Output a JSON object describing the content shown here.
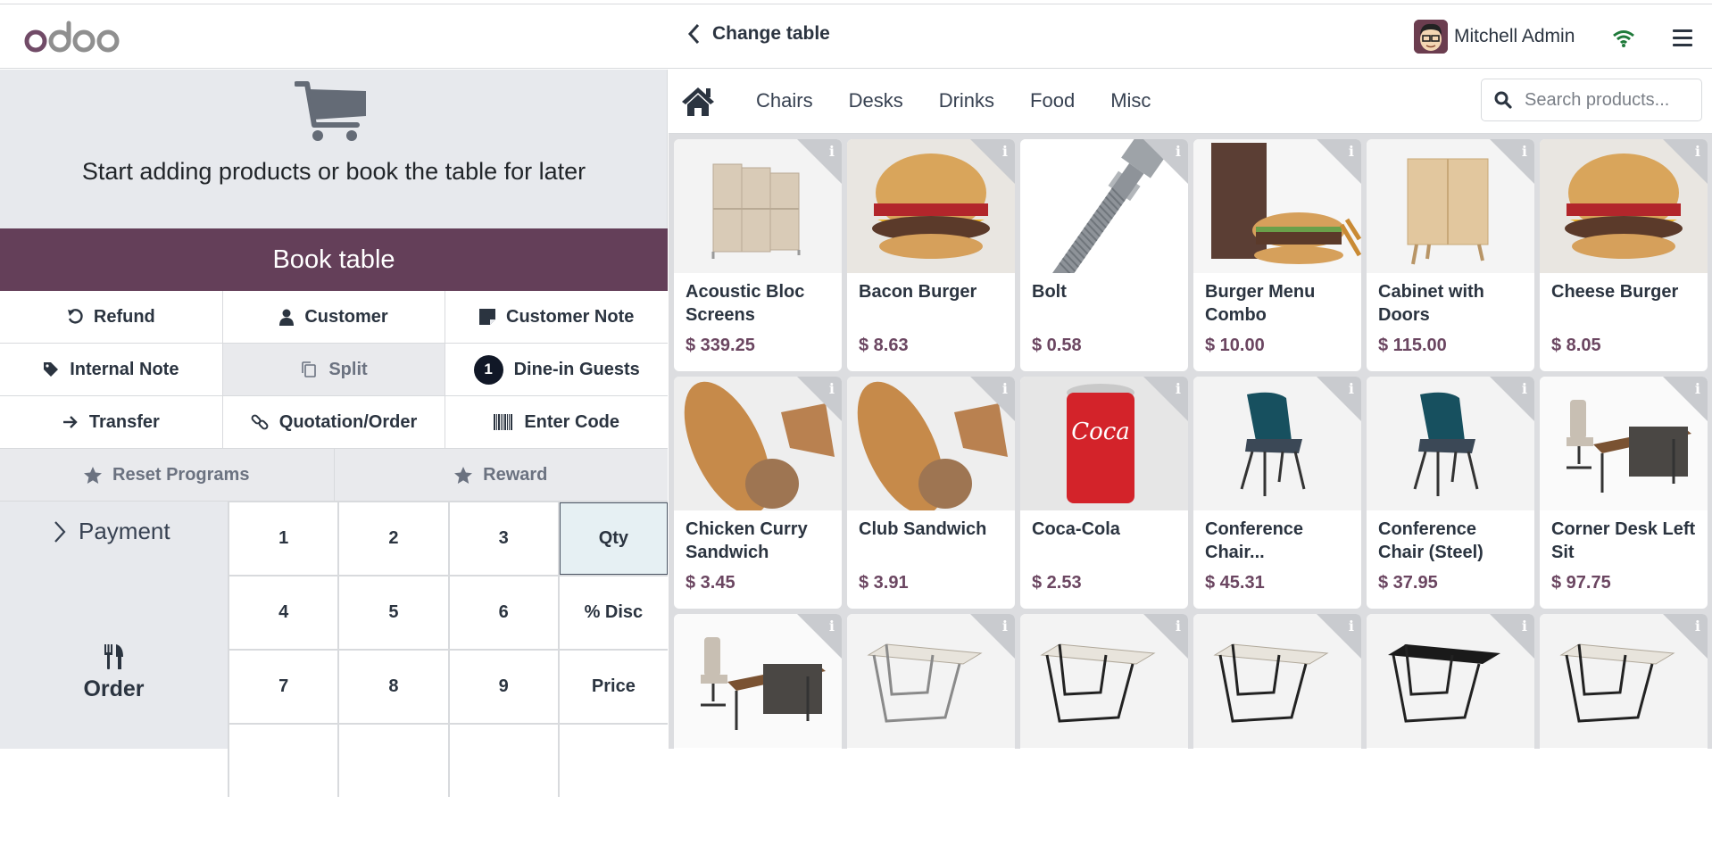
{
  "navbar": {
    "logo": "odoo",
    "change_table_label": "Change table",
    "user_name": "Mitchell Admin",
    "connection_status_icon": "wifi-icon",
    "menu_icon": "hamburger-icon"
  },
  "order_panel": {
    "empty_message": "Start adding products or book the table for later",
    "book_table_label": "Book table",
    "controls": [
      [
        {
          "label": "Refund",
          "icon": "undo-icon",
          "disabled": false
        },
        {
          "label": "Customer",
          "icon": "user-icon",
          "disabled": false
        },
        {
          "label": "Customer Note",
          "icon": "note-icon",
          "disabled": false
        }
      ],
      [
        {
          "label": "Internal Note",
          "icon": "tag-icon",
          "disabled": false
        },
        {
          "label": "Split",
          "icon": "copy-icon",
          "disabled": true
        },
        {
          "label": "Dine-in Guests",
          "icon": "guest-count-badge",
          "badge": "1",
          "disabled": false
        }
      ],
      [
        {
          "label": "Transfer",
          "icon": "arrow-right-icon",
          "disabled": false
        },
        {
          "label": "Quotation/Order",
          "icon": "link-icon",
          "disabled": false
        },
        {
          "label": "Enter Code",
          "icon": "barcode-icon",
          "disabled": false
        }
      ]
    ],
    "programs": [
      {
        "label": "Reset Programs",
        "icon": "star-icon"
      },
      {
        "label": "Reward",
        "icon": "star-icon"
      }
    ],
    "payment_label": "Payment",
    "order_label": "Order",
    "numpad": [
      "1",
      "2",
      "3",
      "Qty",
      "4",
      "5",
      "6",
      "% Disc",
      "7",
      "8",
      "9",
      "Price",
      "",
      "",
      "",
      ""
    ],
    "numpad_active": "Qty"
  },
  "products_panel": {
    "categories": [
      "Chairs",
      "Desks",
      "Drinks",
      "Food",
      "Misc"
    ],
    "search_placeholder": "Search products...",
    "products": [
      {
        "name": "Acoustic Bloc Screens",
        "price": "$ 339.25",
        "image": "screens"
      },
      {
        "name": "Bacon Burger",
        "price": "$ 8.63",
        "image": "burger"
      },
      {
        "name": "Bolt",
        "price": "$ 0.58",
        "image": "bolt"
      },
      {
        "name": "Burger Menu Combo",
        "price": "$ 10.00",
        "image": "combo"
      },
      {
        "name": "Cabinet with Doors",
        "price": "$ 115.00",
        "image": "cabinet"
      },
      {
        "name": "Cheese Burger",
        "price": "$ 8.05",
        "image": "burger"
      },
      {
        "name": "Chicken Curry Sandwich",
        "price": "$ 3.45",
        "image": "sandwich"
      },
      {
        "name": "Club Sandwich",
        "price": "$ 3.91",
        "image": "sandwich"
      },
      {
        "name": "Coca-Cola",
        "price": "$ 2.53",
        "image": "can"
      },
      {
        "name": "Conference Chair...",
        "price": "$ 45.31",
        "image": "chair"
      },
      {
        "name": "Conference Chair (Steel)",
        "price": "$ 37.95",
        "image": "chair"
      },
      {
        "name": "Corner Desk Left Sit",
        "price": "$ 97.75",
        "image": "cornerdesk"
      },
      {
        "name": "",
        "price": "",
        "image": "cornerdesk"
      },
      {
        "name": "",
        "price": "",
        "image": "table-light"
      },
      {
        "name": "",
        "price": "",
        "image": "table"
      },
      {
        "name": "",
        "price": "",
        "image": "table"
      },
      {
        "name": "",
        "price": "",
        "image": "table-black"
      },
      {
        "name": "",
        "price": "",
        "image": "table"
      }
    ],
    "info_icon": "info-icon"
  },
  "colors": {
    "brand": "#643f59",
    "price": "#6b4661",
    "text": "#2b3440",
    "panel_bg": "#e7e9ed"
  }
}
